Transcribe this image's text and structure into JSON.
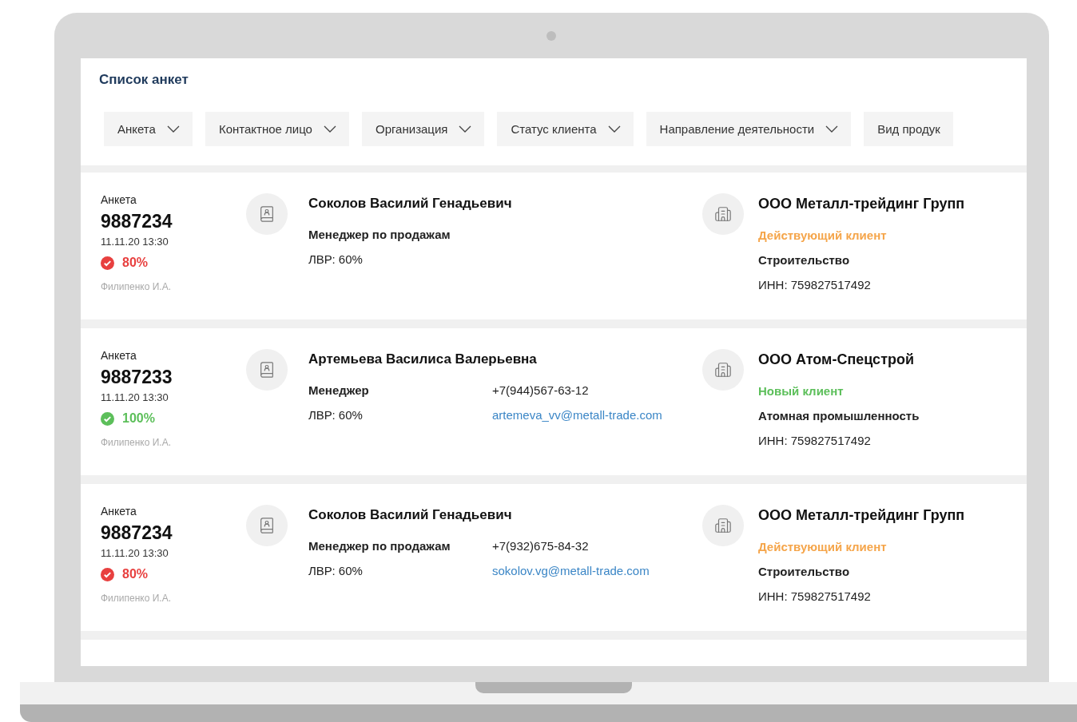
{
  "title": "Список анкет",
  "filters": [
    {
      "label": "Анкета",
      "dropdown": true
    },
    {
      "label": "Контактное лицо",
      "dropdown": true
    },
    {
      "label": "Организация",
      "dropdown": true
    },
    {
      "label": "Статус клиента",
      "dropdown": true
    },
    {
      "label": "Направление деятельности",
      "dropdown": true
    },
    {
      "label": "Вид продук",
      "dropdown": false
    }
  ],
  "cards": [
    {
      "label": "Анкета",
      "number": "9887234",
      "datetime": "11.11.20 13:30",
      "score": {
        "text": "80%",
        "color": "#e8403f"
      },
      "author": "Филипенко И.А.",
      "contact": {
        "name": "Соколов Василий Генадьевич",
        "position": "Менеджер по продажам",
        "lvr": "ЛВР: 60%"
      },
      "organization": {
        "name": "ООО Металл-трейдинг Групп",
        "status": {
          "text": "Действующий клиент",
          "color": "#f5a54a"
        },
        "industry": "Строительство",
        "inn": "ИНН: 759827517492"
      }
    },
    {
      "label": "Анкета",
      "number": "9887233",
      "datetime": "11.11.20 13:30",
      "score": {
        "text": "100%",
        "color": "#5cbf5a"
      },
      "author": "Филипенко И.А.",
      "contact": {
        "name": "Артемьева Василиса Валерьевна",
        "position": "Менеджер",
        "lvr": "ЛВР: 60%",
        "phone": "+7(944)567-63-12",
        "email": "artemeva_vv@metall-trade.com"
      },
      "organization": {
        "name": "ООО Атом-Спецстрой",
        "status": {
          "text": "Новый клиент",
          "color": "#5cbf5a"
        },
        "industry": "Атомная промышленность",
        "inn": "ИНН: 759827517492"
      }
    },
    {
      "label": "Анкета",
      "number": "9887234",
      "datetime": "11.11.20 13:30",
      "score": {
        "text": "80%",
        "color": "#e8403f"
      },
      "author": "Филипенко И.А.",
      "contact": {
        "name": "Соколов Василий Генадьевич",
        "position": "Менеджер по продажам",
        "lvr": "ЛВР: 60%",
        "phone": "+7(932)675-84-32",
        "email": "sokolov.vg@metall-trade.com"
      },
      "organization": {
        "name": "ООО Металл-трейдинг Групп",
        "status": {
          "text": "Действующий клиент",
          "color": "#f5a54a"
        },
        "industry": "Строительство",
        "inn": "ИНН: 759827517492"
      }
    }
  ]
}
